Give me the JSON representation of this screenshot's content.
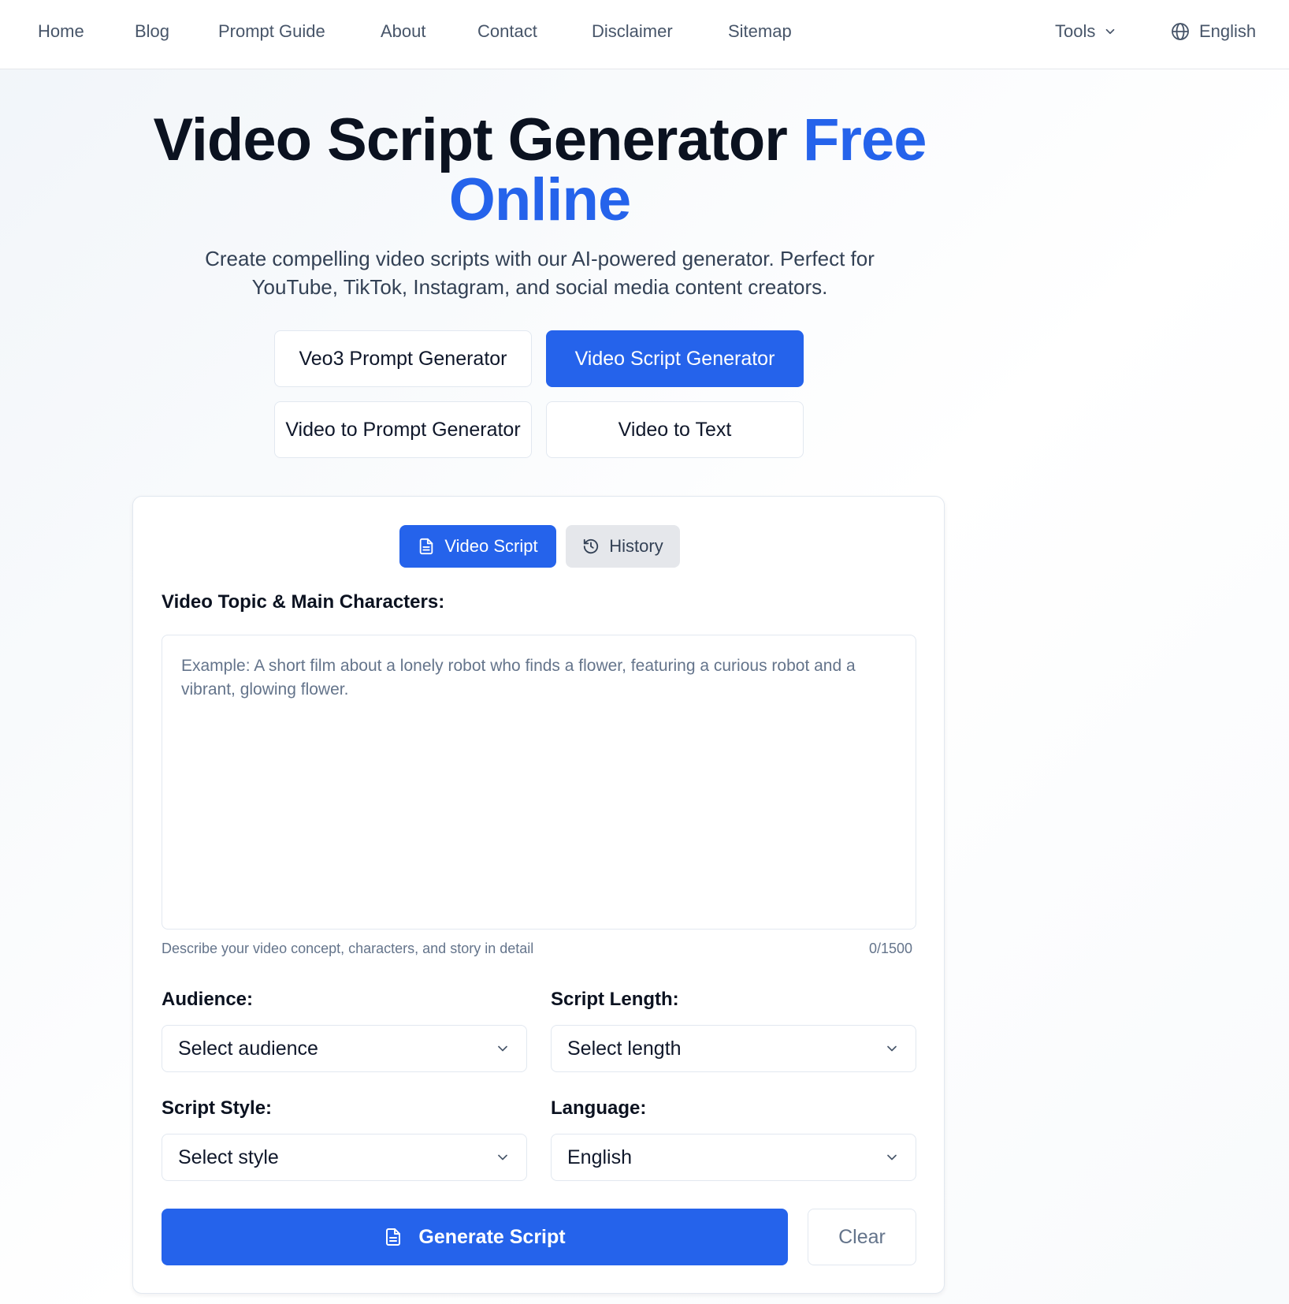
{
  "nav": {
    "links": [
      "Home",
      "Blog",
      "Prompt Guide",
      "About",
      "Contact",
      "Disclaimer",
      "Sitemap"
    ],
    "tools_label": "Tools",
    "language_label": "English"
  },
  "hero": {
    "title_main": "Video Script Generator ",
    "title_accent": "Free Online",
    "subtitle": "Create compelling video scripts with our AI-powered generator. Perfect for YouTube, TikTok, Instagram, and social media content creators."
  },
  "tool_buttons": [
    {
      "label": "Veo3 Prompt Generator",
      "active": false
    },
    {
      "label": "Video Script Generator",
      "active": true
    },
    {
      "label": "Video to Prompt Generator",
      "active": false
    },
    {
      "label": "Video to Text",
      "active": false
    }
  ],
  "tabs": {
    "video_script": "Video Script",
    "history": "History"
  },
  "form": {
    "topic_label": "Video Topic & Main Characters:",
    "topic_value": "",
    "topic_placeholder": "Example: A short film about a lonely robot who finds a flower, featuring a curious robot and a vibrant, glowing flower.",
    "topic_hint": "Describe your video concept, characters, and story in detail",
    "char_count": "0/1500",
    "audience_label": "Audience:",
    "audience_value": "Select audience",
    "length_label": "Script Length:",
    "length_value": "Select length",
    "style_label": "Script Style:",
    "style_value": "Select style",
    "language_label": "Language:",
    "language_value": "English",
    "generate_label": "Generate Script",
    "clear_label": "Clear"
  },
  "colors": {
    "accent": "#2563eb",
    "text_dark": "#0b1220",
    "muted": "#64748b"
  }
}
